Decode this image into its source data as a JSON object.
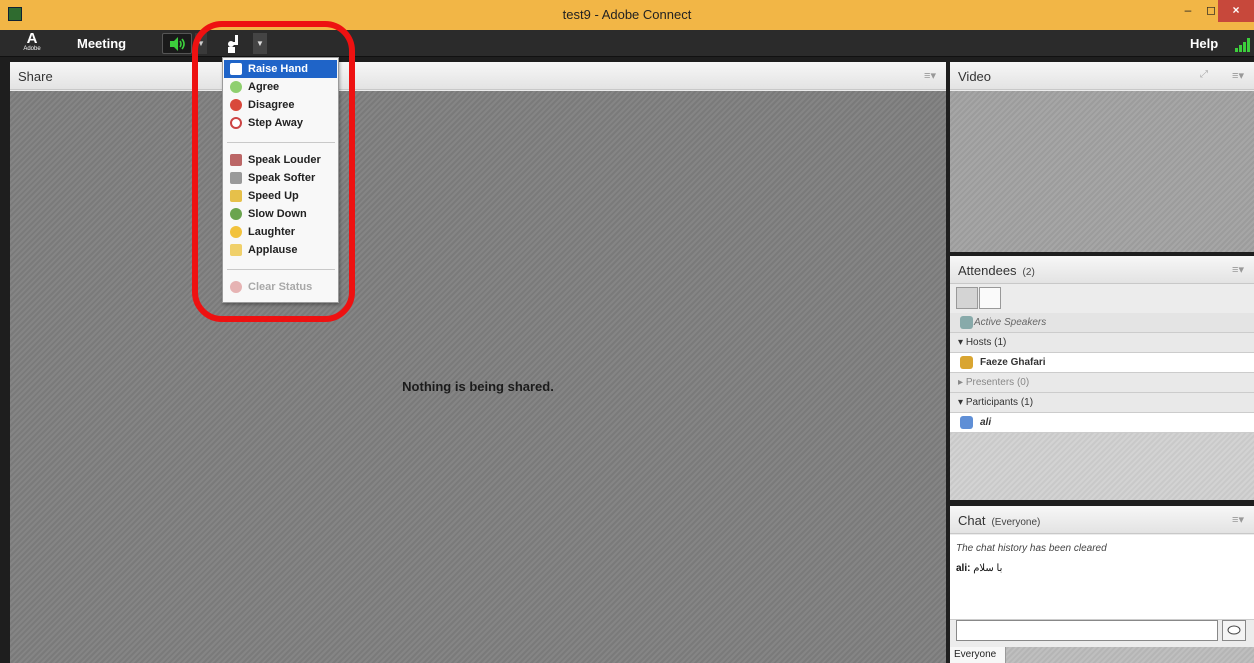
{
  "window": {
    "title": "test9 - Adobe Connect",
    "minimize": "–",
    "maximize": "◻",
    "close": "×"
  },
  "menubar": {
    "logo_mark": "A",
    "logo_text": "Adobe",
    "meeting_label": "Meeting",
    "help_label": "Help",
    "dropdown_arrow": "▼"
  },
  "status_menu": {
    "items": [
      {
        "label": "Raise Hand",
        "icon": "raise-hand-icon",
        "selected": true
      },
      {
        "label": "Agree",
        "icon": "agree-icon"
      },
      {
        "label": "Disagree",
        "icon": "disagree-icon"
      },
      {
        "label": "Step Away",
        "icon": "step-away-icon"
      },
      {
        "label": "Speak Louder",
        "icon": "speak-louder-icon"
      },
      {
        "label": "Speak Softer",
        "icon": "speak-softer-icon"
      },
      {
        "label": "Speed Up",
        "icon": "speed-up-icon"
      },
      {
        "label": "Slow Down",
        "icon": "slow-down-icon"
      },
      {
        "label": "Laughter",
        "icon": "laughter-icon"
      },
      {
        "label": "Applause",
        "icon": "applause-icon"
      },
      {
        "label": "Clear Status",
        "icon": "clear-status-icon",
        "disabled": true
      }
    ]
  },
  "share": {
    "title": "Share",
    "empty_message": "Nothing is being shared.",
    "menu_glyph": "≡▾"
  },
  "video": {
    "title": "Video",
    "menu_glyph": "≡▾"
  },
  "attendees": {
    "title": "Attendees",
    "count": "(2)",
    "menu_glyph": "≡▾",
    "active_speakers": "Active Speakers",
    "hosts_label": "Hosts (1)",
    "host_name": "Faeze Ghafari",
    "presenters_label": "Presenters (0)",
    "participants_label": "Participants (1)",
    "participant_name": "ali"
  },
  "chat": {
    "title": "Chat",
    "scope": "(Everyone)",
    "menu_glyph": "≡▾",
    "history_note": "The chat history has been cleared",
    "message_sender": "ali:",
    "message_text": "با سلام",
    "input_value": "",
    "tab_label": "Everyone"
  },
  "colors": {
    "titlebar": "#f2b646",
    "menubar": "#2b2b2b",
    "selection": "#1f64c8",
    "highlight": "#ee1111",
    "audio_green": "#3ccf3c"
  }
}
